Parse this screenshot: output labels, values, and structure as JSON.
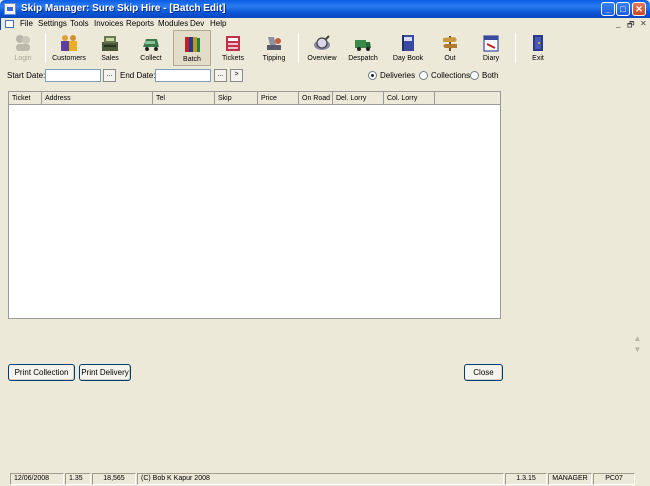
{
  "window": {
    "title": "Skip Manager: Sure Skip Hire - [Batch Edit]",
    "controls": {
      "minimize": "_",
      "maximize": "□",
      "close": "✕"
    }
  },
  "menu": {
    "items": [
      "File",
      "Settings",
      "Tools",
      "Invoices",
      "Reports",
      "Modules",
      "Dev",
      "Help"
    ],
    "mdi_controls": [
      "_",
      "🗗",
      "✕"
    ]
  },
  "toolbar": {
    "buttons": [
      {
        "label": "Login",
        "icon": "login-icon",
        "disabled": true
      },
      {
        "label": "Customers",
        "icon": "customers-icon"
      },
      {
        "label": "Sales",
        "icon": "sales-icon"
      },
      {
        "label": "Collect",
        "icon": "collect-icon"
      },
      {
        "label": "Batch",
        "icon": "batch-icon",
        "active": true
      },
      {
        "label": "Tickets",
        "icon": "tickets-icon"
      },
      {
        "label": "Tipping",
        "icon": "tipping-icon"
      },
      {
        "label": "Overview",
        "icon": "overview-icon"
      },
      {
        "label": "Despatch",
        "icon": "despatch-icon"
      },
      {
        "label": "Day Book",
        "icon": "daybook-icon"
      },
      {
        "label": "Out",
        "icon": "out-icon"
      },
      {
        "label": "Diary",
        "icon": "diary-icon"
      },
      {
        "label": "Exit",
        "icon": "exit-icon"
      }
    ]
  },
  "filters": {
    "start_label": "Start Date:",
    "start_value": "",
    "start_button": "...",
    "end_label": "End Date:",
    "end_value": "",
    "end_button": "...",
    "go_button": ">",
    "radios": [
      {
        "label": "Deliveries",
        "selected": true
      },
      {
        "label": "Collections",
        "selected": false
      },
      {
        "label": "Both",
        "selected": false
      }
    ]
  },
  "grid": {
    "columns": [
      "Ticket",
      "Address",
      "Tel",
      "Skip",
      "Price",
      "On Road",
      "Del. Lorry",
      "Col. Lorry"
    ],
    "rows": []
  },
  "actions": {
    "print_collection": "Print Collection",
    "print_delivery": "Print Delivery",
    "close": "Close"
  },
  "status": {
    "date": "12/06/2008",
    "time": "1.35",
    "count": "18,565",
    "copyright": "(C) Bob K Kapur 2008",
    "version": "1.3.15",
    "user": "MANAGER",
    "machine": "PC07"
  }
}
